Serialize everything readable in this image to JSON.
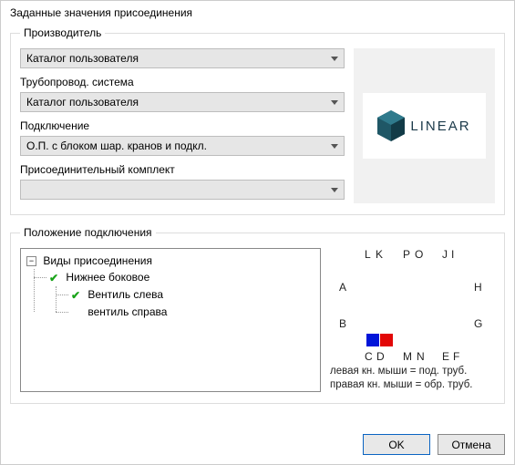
{
  "window": {
    "title": "Заданные значения присоединения"
  },
  "manufacturer": {
    "legend": "Производитель",
    "catalog": "Каталог пользователя",
    "pipe_system_label": "Трубопровод. система",
    "pipe_system_value": "Каталог пользователя",
    "connection_label": "Подключение",
    "connection_value": "О.П. с блоком шар. кранов и подкл.",
    "kit_label": "Присоединительный комплект",
    "kit_value": "",
    "logo_text": "LINEAR"
  },
  "position": {
    "legend": "Положение подключения",
    "tree": {
      "root": "Виды присоединения",
      "child1": "Нижнее боковое",
      "leaf_left": "Вентиль слева",
      "leaf_right": "вентиль справа"
    },
    "labels": {
      "L": "L",
      "K": "K",
      "P": "P",
      "O": "O",
      "J": "J",
      "I": "I",
      "A": "A",
      "H": "H",
      "B": "B",
      "G": "G",
      "C": "C",
      "D": "D",
      "M": "M",
      "N": "N",
      "E": "E",
      "F": "F"
    },
    "hint1": "левая кн. мыши = под. труб.",
    "hint2": "правая кн. мыши = обр. труб."
  },
  "buttons": {
    "ok": "OK",
    "cancel": "Отмена"
  }
}
